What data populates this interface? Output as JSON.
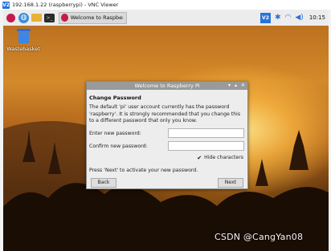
{
  "vnc_window": {
    "title": "192.168.1.22 (raspberrypi) - VNC Viewer",
    "logo_text": "V2"
  },
  "taskbar": {
    "icons": [
      "raspberry-pi-menu-icon",
      "globe-icon",
      "folder-icon",
      "terminal-icon"
    ],
    "task_button_label": "Welcome to Raspberr...",
    "tray": {
      "vnc_text": "V2",
      "clock": "10:15"
    }
  },
  "desktop": {
    "trash_label": "Wastebasket"
  },
  "dialog": {
    "window_title": "Welcome to Raspberry Pi",
    "heading": "Change Password",
    "description": "The default 'pi' user account currently has the password 'raspberry'. It is strongly recommended that you change this to a different password that only you know.",
    "new_password_label": "Enter new password:",
    "new_password_value": "",
    "confirm_password_label": "Confirm new password:",
    "confirm_password_value": "",
    "hide_characters_label": "Hide characters",
    "hide_characters_checked": true,
    "hint": "Press 'Next' to activate your new password.",
    "back_label": "Back",
    "next_label": "Next"
  },
  "watermark": "CSDN @CangYan08",
  "colors": {
    "vnc_blue": "#2a73d9",
    "raspberry_red": "#c51a4a",
    "dialog_bg": "#ededed",
    "dialog_titlebar": "#9a9a9a"
  }
}
